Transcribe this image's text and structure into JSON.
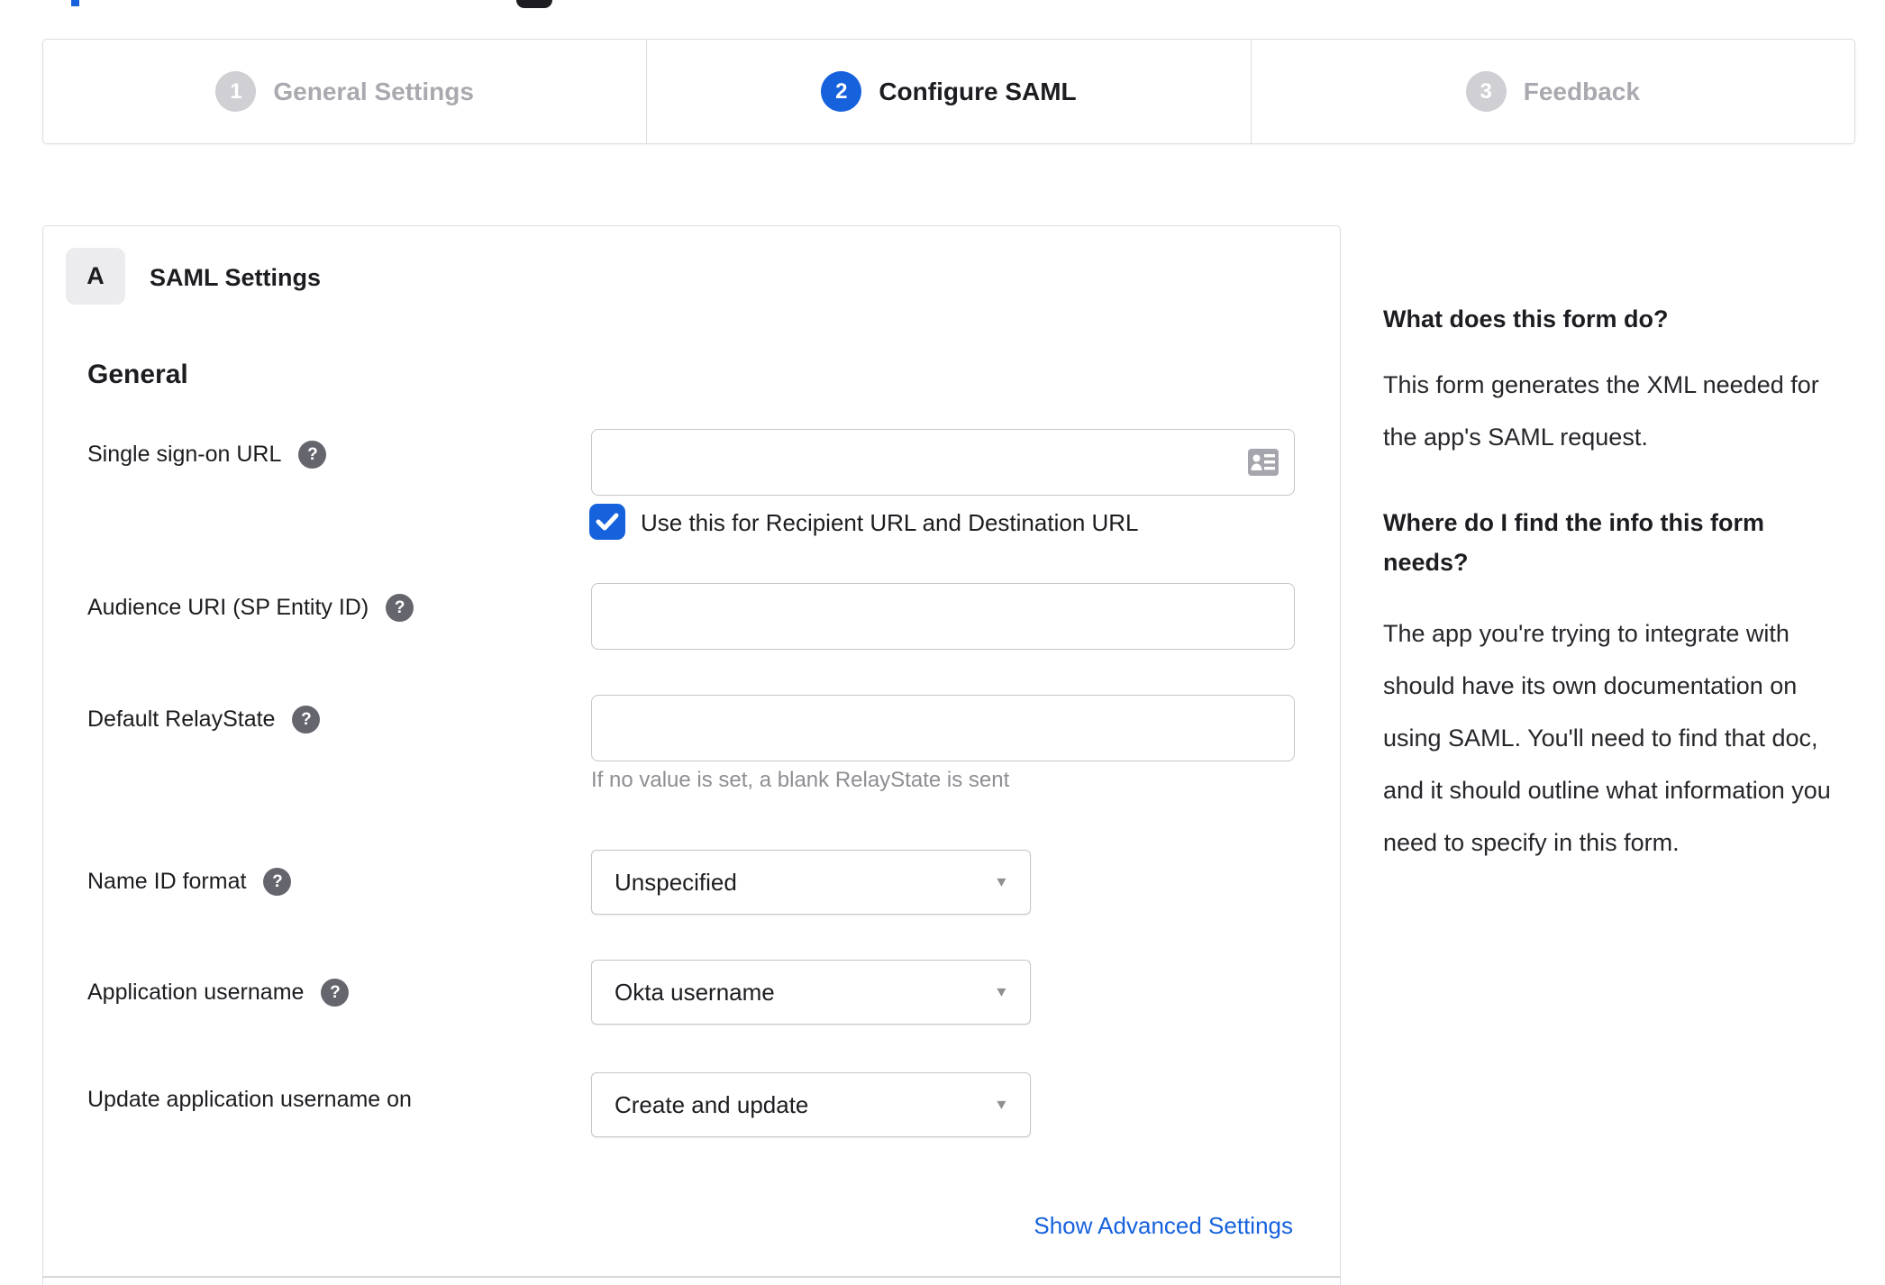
{
  "stepper": {
    "steps": [
      {
        "number": "1",
        "label": "General Settings",
        "state": "inactive"
      },
      {
        "number": "2",
        "label": "Configure SAML",
        "state": "active"
      },
      {
        "number": "3",
        "label": "Feedback",
        "state": "inactive"
      }
    ]
  },
  "panel": {
    "badge": "A",
    "title": "SAML Settings",
    "section_heading": "General",
    "fields": {
      "sso_url": {
        "label": "Single sign-on URL",
        "value": ""
      },
      "sso_checkbox": {
        "label": "Use this for Recipient URL and Destination URL",
        "checked": true
      },
      "audience_uri": {
        "label": "Audience URI (SP Entity ID)",
        "value": ""
      },
      "relay_state": {
        "label": "Default RelayState",
        "value": "",
        "helper": "If no value is set, a blank RelayState is sent"
      },
      "name_id_format": {
        "label": "Name ID format",
        "value": "Unspecified"
      },
      "app_username": {
        "label": "Application username",
        "value": "Okta username"
      },
      "update_username_on": {
        "label": "Update application username on",
        "value": "Create and update"
      }
    },
    "advanced_link": "Show Advanced Settings"
  },
  "sidebar": {
    "sections": [
      {
        "heading": "What does this form do?",
        "body": "This form generates the XML needed for the app's SAML request."
      },
      {
        "heading": "Where do I find the info this form needs?",
        "body": "The app you're trying to integrate with should have its own documentation on using SAML. You'll need to find that doc, and it should outline what information you need to specify in this form."
      }
    ]
  },
  "icons": {
    "help": "?",
    "caret_down": "▼",
    "checkmark": "✓",
    "contact_card": "contact-card"
  },
  "colors": {
    "accent_blue": "#1662dd",
    "text": "#1d1d21",
    "muted_gray": "#8e8e93",
    "inactive_gray": "#a9a9af",
    "border_gray": "#dddde1"
  }
}
